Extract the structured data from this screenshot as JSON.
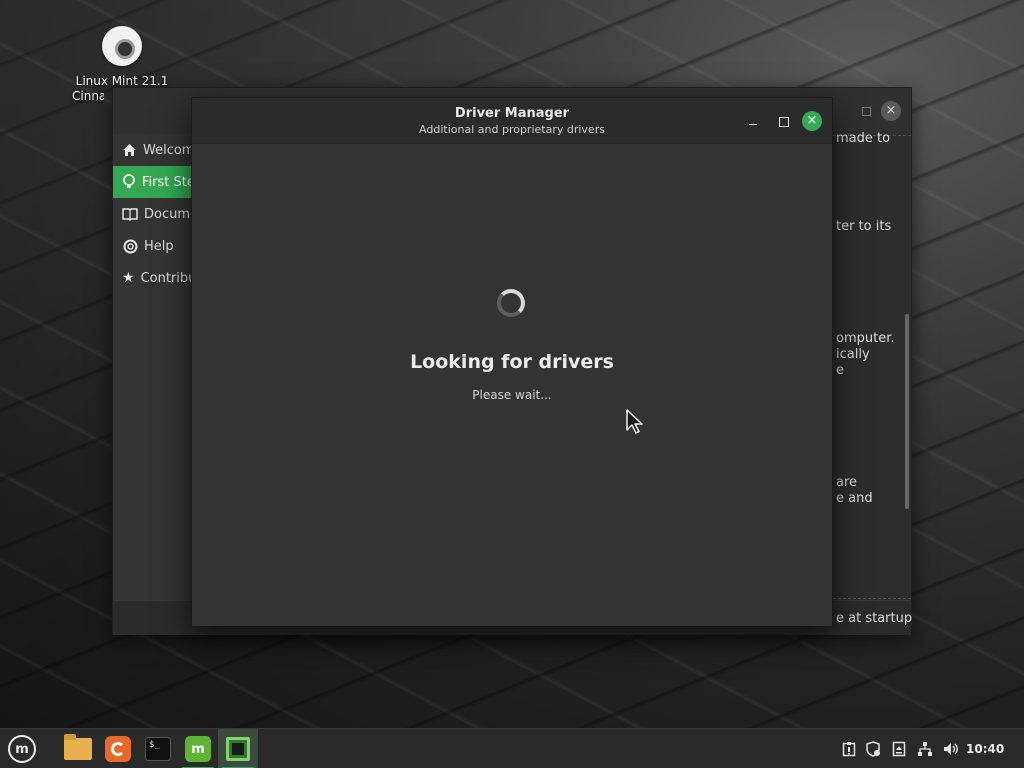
{
  "desktop": {
    "icon_label_line1": "Linux Mint 21.1",
    "icon_label_line2": "Cinnamon"
  },
  "welcome_window": {
    "sidebar": [
      {
        "label": "Welcome",
        "icon": "home-icon",
        "active": false
      },
      {
        "label": "First Steps",
        "icon": "lightbulb-icon",
        "active": true
      },
      {
        "label": "Documentation",
        "icon": "book-icon",
        "active": false
      },
      {
        "label": "Help",
        "icon": "lifebuoy-icon",
        "active": false
      },
      {
        "label": "Contribute",
        "icon": "star-icon",
        "active": false
      }
    ],
    "snippets": [
      "made to",
      "ter to its",
      "omputer.",
      "ically",
      "e",
      "are",
      "e and"
    ],
    "footer_text": "e at startup"
  },
  "driver_manager": {
    "title": "Driver Manager",
    "subtitle": "Additional and proprietary drivers",
    "heading": "Looking for drivers",
    "status": "Please wait..."
  },
  "taskbar": {
    "menu_label": "m",
    "terminal_glyph": "$_",
    "mint_app_label": "m",
    "clock": "10:40",
    "tray_icons": [
      "clipboard-icon",
      "shield-update-icon",
      "notes-icon",
      "network-icon",
      "volume-icon"
    ]
  },
  "colors": {
    "accent": "#35a854"
  }
}
